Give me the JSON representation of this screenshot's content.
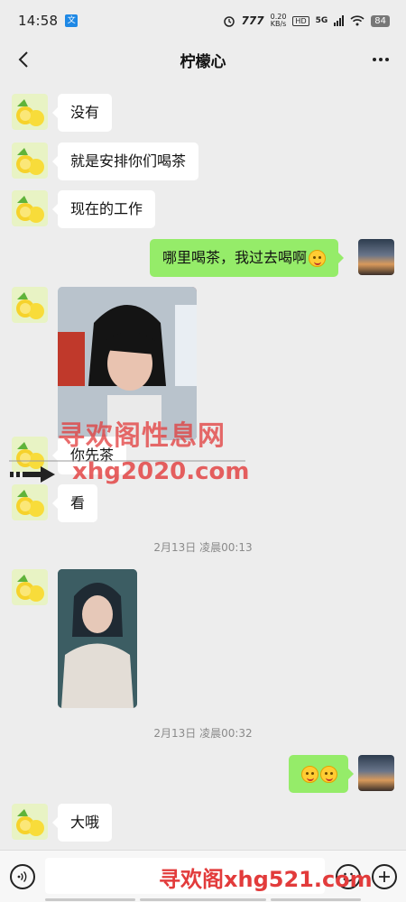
{
  "status_bar": {
    "time": "14:58",
    "app_badge": "文",
    "network_speed": "0.20",
    "network_unit": "KB/s",
    "hd_label": "HD",
    "signal_label": "5G",
    "battery": "84"
  },
  "header": {
    "title": "柠檬心",
    "back_icon": "chevron-left-icon",
    "more_icon": "ellipsis-icon"
  },
  "messages": [
    {
      "side": "left",
      "type": "text",
      "text": "没有"
    },
    {
      "side": "left",
      "type": "text",
      "text": "就是安排你们喝茶"
    },
    {
      "side": "left",
      "type": "text",
      "text": "现在的工作"
    },
    {
      "side": "right",
      "type": "text",
      "text": "哪里喝茶，我过去喝啊",
      "emoji": "thinking-emoji"
    },
    {
      "side": "left",
      "type": "image",
      "image": "photo-woman-bob-hair"
    },
    {
      "side": "left",
      "type": "text",
      "text": "你先茶"
    },
    {
      "side": "left",
      "type": "text",
      "text": "看"
    },
    {
      "type": "timestamp",
      "text": "2月13日 凌晨00:13"
    },
    {
      "side": "left",
      "type": "image",
      "image": "photo-woman-white-top"
    },
    {
      "type": "timestamp",
      "text": "2月13日 凌晨00:32"
    },
    {
      "side": "right",
      "type": "emoji",
      "emoji": "blushing-emoji-x2"
    },
    {
      "side": "left",
      "type": "text",
      "text": "大哦"
    }
  ],
  "watermark": {
    "line1": "寻欢阁性息网",
    "line2": "xhg2020.com",
    "footer": "寻欢阁xhg521.com"
  },
  "colors": {
    "background": "#ededed",
    "sent_bubble": "#95ec69",
    "received_bubble": "#ffffff",
    "watermark": "#e23b3b"
  }
}
